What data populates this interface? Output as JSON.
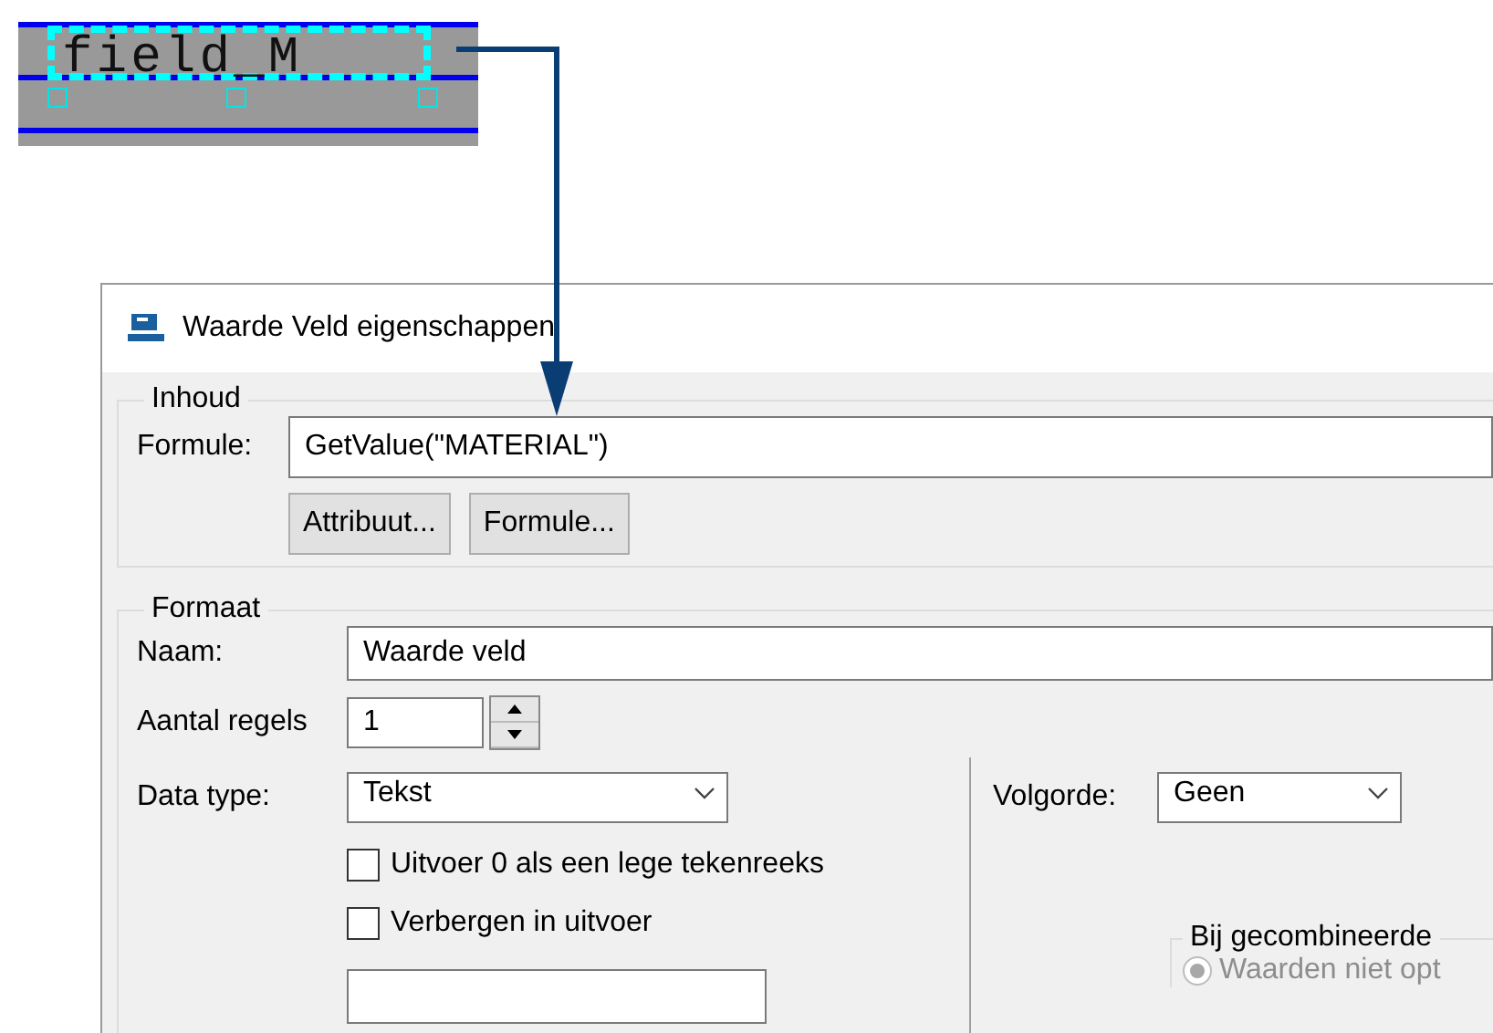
{
  "canvas_field": {
    "text": "field_M",
    "selected": true
  },
  "dialog": {
    "title": "Waarde Veld eigenschappen",
    "inhoud": {
      "legend": "Inhoud",
      "formula_label": "Formule:",
      "formula_value": "GetValue(\"MATERIAL\")",
      "buttons": [
        "Attribuut...",
        "Formule..."
      ]
    },
    "formaat": {
      "legend": "Formaat",
      "name_label": "Naam:",
      "name_value": "Waarde veld",
      "lines_label": "Aantal regels",
      "lines_value": "1",
      "data_type_label": "Data type:",
      "data_type_value": "Tekst",
      "order_label": "Volgorde:",
      "order_value": "Geen",
      "checkboxes": [
        {
          "label": "Uitvoer 0 als een lege tekenreeks",
          "checked": false
        },
        {
          "label": "Verbergen in uitvoer",
          "checked": false
        }
      ],
      "combined": {
        "legend": "Bij gecombineerde",
        "options": [
          {
            "label": "Waarden niet opt",
            "selected": true,
            "disabled": true
          }
        ]
      }
    }
  }
}
